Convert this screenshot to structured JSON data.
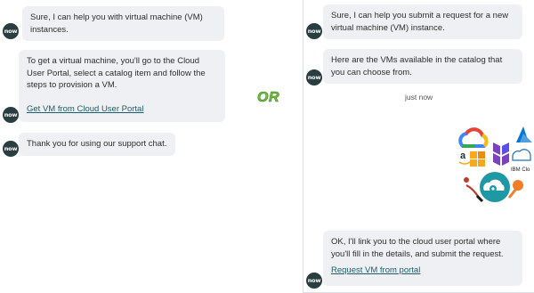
{
  "left_chat": {
    "avatar_text": "now",
    "msg1": "Sure, I can help you with virtual machine (VM) instances.",
    "msg2_text": "To get a virtual machine, you'll go to the Cloud User Portal, select a catalog item and follow the steps to provision a VM.",
    "msg2_link": "Get VM from Cloud User Portal",
    "msg3": "Thank you for using our support chat."
  },
  "divider_label": "OR",
  "right_chat": {
    "avatar_text": "now",
    "msg1": "Sure, I can help you submit a request for a new virtual machine (VM) instance.",
    "msg2": "Here are the VMs available in the catalog that you can choose from.",
    "timestamp": "just now",
    "msg3_text": "OK, I'll link you to the cloud user portal where you'll fill in the details, and submit the request.",
    "msg3_link": "Request VM from portal"
  },
  "catalog_logos": {
    "names": [
      "google-cloud-icon",
      "azure-icon",
      "terraform-icon",
      "aws-icon",
      "ibm-cloud-icon",
      "cloud-tools-icon"
    ],
    "ibm_label": "IBM Clo",
    "aws_label": "a",
    "colors": {
      "google_blue": "#4285f4",
      "google_red": "#ea4335",
      "google_yellow": "#fbbc05",
      "google_green": "#34a853",
      "terraform": "#7b42bc",
      "aws_orange": "#f7a81b",
      "azure": "#0078d4",
      "tools_bg": "#1f98a5",
      "tools_orange": "#f07e26"
    }
  },
  "colors": {
    "bubble_bg": "#eef0f3",
    "avatar_bg": "#293e40",
    "link": "#1a5f6b",
    "or_fill": "#74c043"
  }
}
